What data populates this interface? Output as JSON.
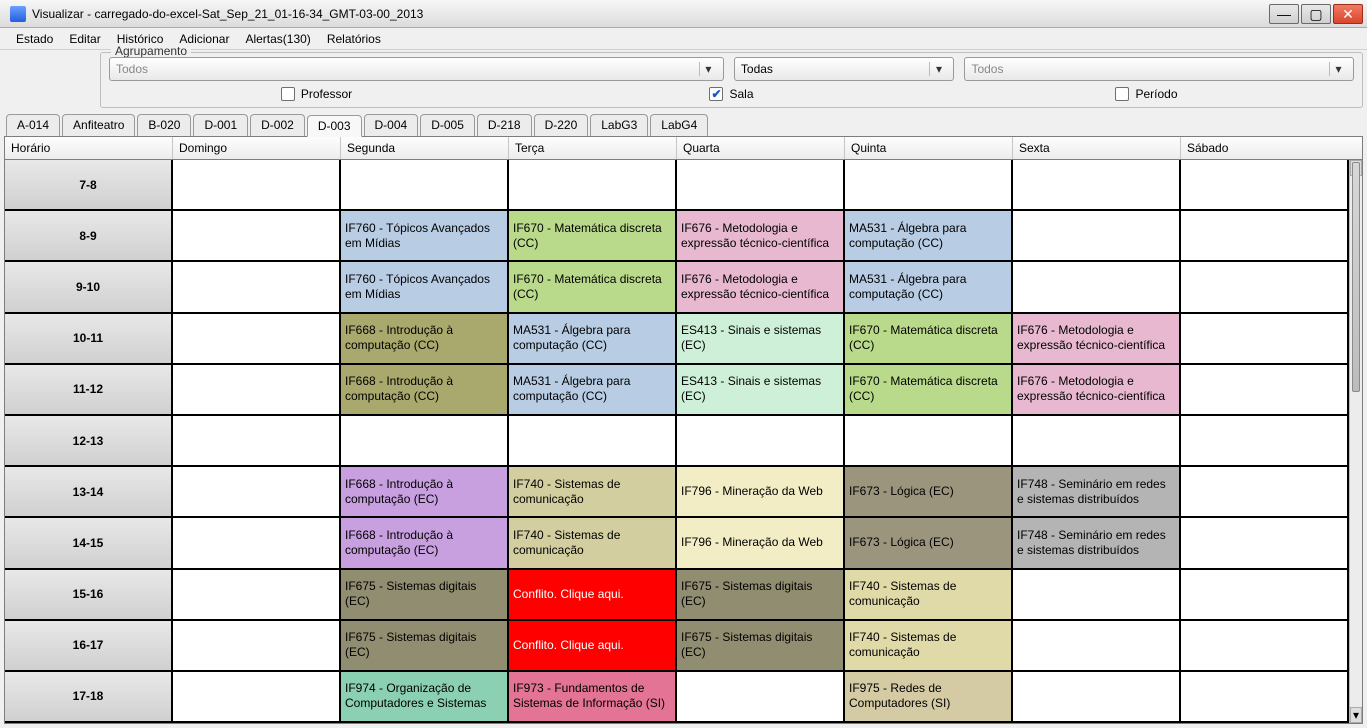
{
  "title": "Visualizar - carregado-do-excel-Sat_Sep_21_01-16-34_GMT-03-00_2013",
  "menu": [
    "Estado",
    "Editar",
    "Histórico",
    "Adicionar",
    "Alertas(130)",
    "Relatórios"
  ],
  "group": {
    "legend": "Agrupamento",
    "dd1": "Todos",
    "dd2": "Todas",
    "dd3": "Todos",
    "chk_professor": {
      "label": "Professor",
      "checked": false
    },
    "chk_sala": {
      "label": "Sala",
      "checked": true
    },
    "chk_periodo": {
      "label": "Período",
      "checked": false
    }
  },
  "tabs": [
    "A-014",
    "Anfiteatro",
    "B-020",
    "D-001",
    "D-002",
    "D-003",
    "D-004",
    "D-005",
    "D-218",
    "D-220",
    "LabG3",
    "LabG4"
  ],
  "active_tab": "D-003",
  "headers": [
    "Horário",
    "Domingo",
    "Segunda",
    "Terça",
    "Quarta",
    "Quinta",
    "Sexta",
    "Sábado"
  ],
  "rows": [
    {
      "time": "7-8",
      "cells": [
        null,
        null,
        null,
        null,
        null,
        null,
        null
      ]
    },
    {
      "time": "8-9",
      "cells": [
        null,
        {
          "t": "IF760 - Tópicos Avançados em Mídias",
          "c": "c-blue"
        },
        {
          "t": "IF670 - Matemática discreta (CC)",
          "c": "c-green"
        },
        {
          "t": "IF676 - Metodologia e expressão técnico-científica",
          "c": "c-pink"
        },
        {
          "t": "MA531 - Álgebra para computação (CC)",
          "c": "c-blue"
        },
        null,
        null
      ]
    },
    {
      "time": "9-10",
      "cells": [
        null,
        {
          "t": "IF760 - Tópicos Avançados em Mídias",
          "c": "c-blue"
        },
        {
          "t": "IF670 - Matemática discreta (CC)",
          "c": "c-green"
        },
        {
          "t": "IF676 - Metodologia e expressão técnico-científica",
          "c": "c-pink"
        },
        {
          "t": "MA531 - Álgebra para computação (CC)",
          "c": "c-blue"
        },
        null,
        null
      ]
    },
    {
      "time": "10-11",
      "cells": [
        null,
        {
          "t": "IF668 - Introdução à computação (CC)",
          "c": "c-olive"
        },
        {
          "t": "MA531 - Álgebra para computação (CC)",
          "c": "c-blue"
        },
        {
          "t": "ES413 - Sinais e sistemas (EC)",
          "c": "c-mint"
        },
        {
          "t": "IF670 - Matemática discreta (CC)",
          "c": "c-green"
        },
        {
          "t": "IF676 - Metodologia e expressão técnico-científica",
          "c": "c-pink"
        },
        null
      ]
    },
    {
      "time": "11-12",
      "cells": [
        null,
        {
          "t": "IF668 - Introdução à computação (CC)",
          "c": "c-olive"
        },
        {
          "t": "MA531 - Álgebra para computação (CC)",
          "c": "c-blue"
        },
        {
          "t": "ES413 - Sinais e sistemas (EC)",
          "c": "c-mint"
        },
        {
          "t": "IF670 - Matemática discreta (CC)",
          "c": "c-green"
        },
        {
          "t": "IF676 - Metodologia e expressão técnico-científica",
          "c": "c-pink"
        },
        null
      ]
    },
    {
      "time": "12-13",
      "cells": [
        null,
        null,
        null,
        null,
        null,
        null,
        null
      ]
    },
    {
      "time": "13-14",
      "cells": [
        null,
        {
          "t": "IF668 - Introdução à computação (EC)",
          "c": "c-purple"
        },
        {
          "t": "IF740 - Sistemas de comunicação",
          "c": "c-khaki"
        },
        {
          "t": "IF796 - Mineração da Web",
          "c": "c-cream"
        },
        {
          "t": "IF673 - Lógica (EC)",
          "c": "c-brown"
        },
        {
          "t": "IF748 - Seminário em redes e sistemas distribuídos",
          "c": "c-gray"
        },
        null
      ]
    },
    {
      "time": "14-15",
      "cells": [
        null,
        {
          "t": "IF668 - Introdução à computação (EC)",
          "c": "c-purple"
        },
        {
          "t": "IF740 - Sistemas de comunicação",
          "c": "c-khaki"
        },
        {
          "t": "IF796 - Mineração da Web",
          "c": "c-cream"
        },
        {
          "t": "IF673 - Lógica (EC)",
          "c": "c-brown"
        },
        {
          "t": "IF748 - Seminário em redes e sistemas distribuídos",
          "c": "c-gray"
        },
        null
      ]
    },
    {
      "time": "15-16",
      "cells": [
        null,
        {
          "t": "IF675 - Sistemas digitais (EC)",
          "c": "c-tan"
        },
        {
          "t": "Conflito. Clique aqui.",
          "c": "c-red"
        },
        {
          "t": "IF675 - Sistemas digitais (EC)",
          "c": "c-tan"
        },
        {
          "t": "IF740 - Sistemas de comunicação",
          "c": "c-beige"
        },
        null,
        null
      ]
    },
    {
      "time": "16-17",
      "cells": [
        null,
        {
          "t": "IF675 - Sistemas digitais (EC)",
          "c": "c-tan"
        },
        {
          "t": "Conflito. Clique aqui.",
          "c": "c-red"
        },
        {
          "t": "IF675 - Sistemas digitais (EC)",
          "c": "c-tan"
        },
        {
          "t": "IF740 - Sistemas de comunicação",
          "c": "c-beige"
        },
        null,
        null
      ]
    },
    {
      "time": "17-18",
      "cells": [
        null,
        {
          "t": "IF974 - Organização de Computadores e Sistemas",
          "c": "c-teal"
        },
        {
          "t": "IF973 - Fundamentos de Sistemas de Informação (SI)",
          "c": "c-rose"
        },
        null,
        {
          "t": "IF975 - Redes de Computadores (SI)",
          "c": "c-sand"
        },
        null,
        null
      ]
    }
  ]
}
